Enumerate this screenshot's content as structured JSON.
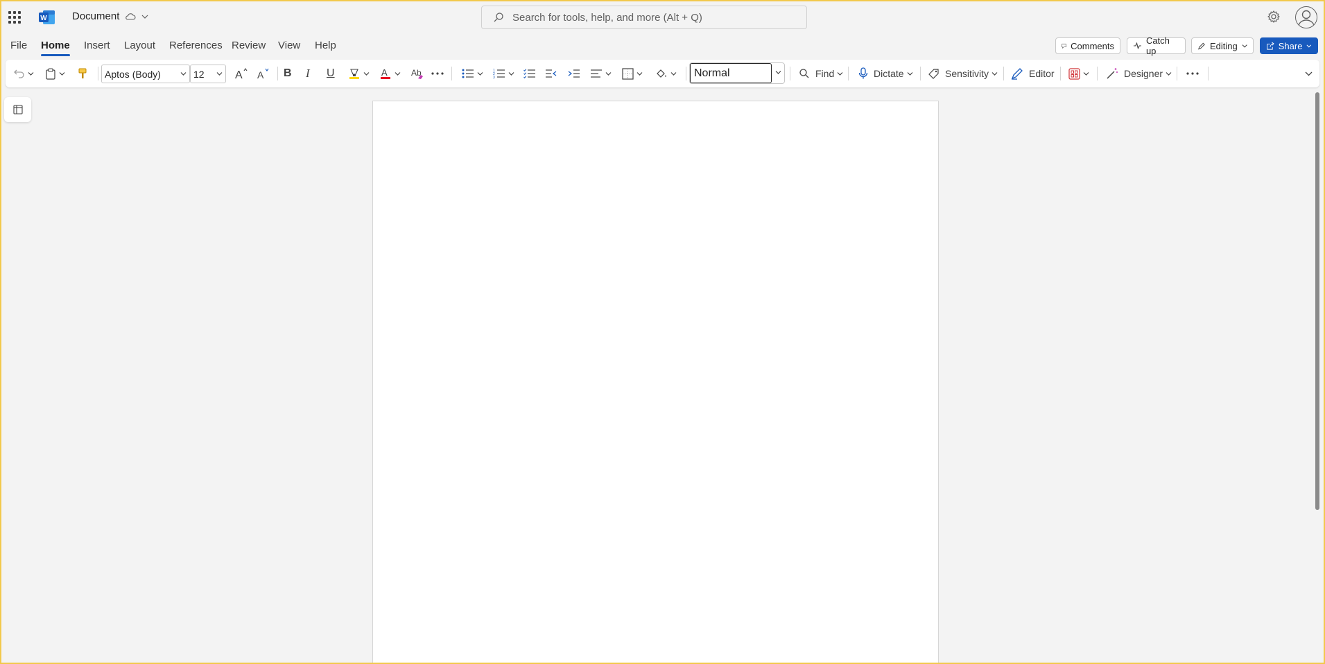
{
  "app": {
    "title": "Document",
    "cloud_icon": "cloud-icon",
    "brand_color": "#185abd"
  },
  "search": {
    "placeholder": "Search for tools, help, and more (Alt + Q)"
  },
  "menu": {
    "tabs": [
      {
        "label": "File"
      },
      {
        "label": "Home"
      },
      {
        "label": "Insert"
      },
      {
        "label": "Layout"
      },
      {
        "label": "References"
      },
      {
        "label": "Review"
      },
      {
        "label": "View"
      },
      {
        "label": "Help"
      }
    ],
    "active_tab": "Home"
  },
  "actions": {
    "comments": "Comments",
    "catch_up": "Catch up",
    "editing": "Editing",
    "share": "Share"
  },
  "ribbon": {
    "font_name": "Aptos (Body)",
    "font_size": "12",
    "bold": "B",
    "italic": "I",
    "underline": "U",
    "style": "Normal",
    "find": "Find",
    "dictate": "Dictate",
    "sensitivity": "Sensitivity",
    "editor": "Editor",
    "designer": "Designer"
  },
  "colors": {
    "font_color_swatch": "#e81123",
    "highlight_swatch": "#ffd800",
    "frame_accent": "#f2c94c"
  }
}
